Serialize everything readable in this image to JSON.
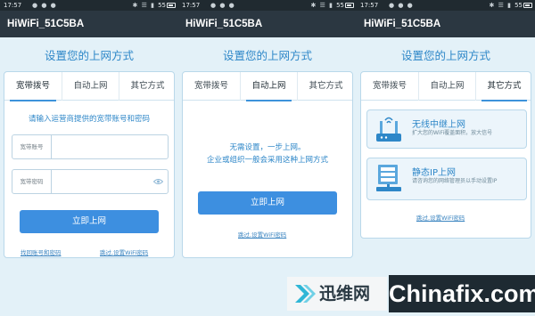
{
  "screens": [
    {
      "status": {
        "time": "17:57",
        "icons": "● ● ●",
        "sicons": "✱ ☰ ▮",
        "battery": "55"
      },
      "title": "HiWiFi_51C5BA",
      "heading": "设置您的上网方式",
      "tabs": [
        "宽带拨号",
        "自动上网",
        "其它方式"
      ],
      "prompt": "请输入运营商提供的宽带账号和密码",
      "account_label": "宽带账号",
      "password_label": "宽带密码",
      "button": "立即上网",
      "link_left": "找回账号和密码",
      "link_right": "跳过,设置WiFi密码"
    },
    {
      "status": {
        "time": "17:57",
        "icons": "● ● ●",
        "sicons": "✱ ☰ ▮",
        "battery": "55"
      },
      "title": "HiWiFi_51C5BA",
      "heading": "设置您的上网方式",
      "tabs": [
        "宽带拨号",
        "自动上网",
        "其它方式"
      ],
      "line1": "无需设置，一步上网。",
      "line2": "企业或组织一般会采用这种上网方式",
      "button": "立即上网",
      "link": "跳过,设置WiFi密码"
    },
    {
      "status": {
        "time": "17:57",
        "icons": "● ● ●",
        "sicons": "✱ ☰ ▮",
        "battery": "55"
      },
      "title": "HiWiFi_51C5BA",
      "heading": "设置您的上网方式",
      "tabs": [
        "宽带拨号",
        "自动上网",
        "其它方式"
      ],
      "options": [
        {
          "title": "无线中继上网",
          "desc": "扩大您的WiFi覆盖面积，放大信号"
        },
        {
          "title": "静态IP上网",
          "desc": "请咨询您的网络管理员以手动设置IP"
        }
      ],
      "link": "跳过,设置WiFi密码"
    }
  ],
  "watermark": {
    "logo_text": "迅维网",
    "site": "Chinafix.com"
  },
  "colors": {
    "accent": "#3d8fe0",
    "heading": "#2e87c8",
    "titlebar": "#2b3741",
    "background": "#e3f1f8"
  }
}
